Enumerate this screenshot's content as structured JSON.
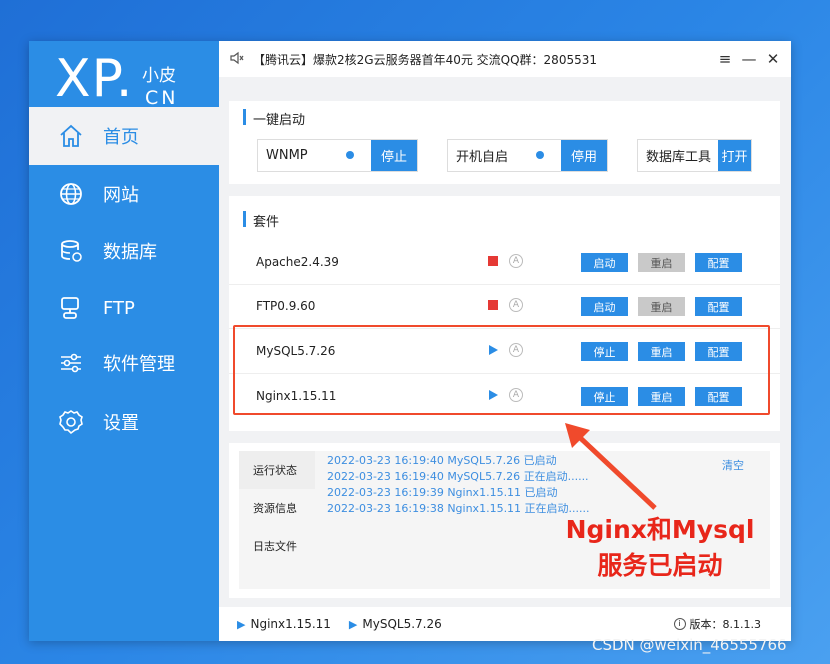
{
  "sidebar": {
    "logo": {
      "xp": "XP.",
      "small": "小皮",
      "cn": "CN"
    },
    "items": [
      {
        "label": "首页",
        "icon": "home-icon",
        "active": true
      },
      {
        "label": "网站",
        "icon": "globe-icon"
      },
      {
        "label": "数据库",
        "icon": "database-icon"
      },
      {
        "label": "FTP",
        "icon": "server-icon"
      },
      {
        "label": "软件管理",
        "icon": "sliders-icon"
      },
      {
        "label": "设置",
        "icon": "gear-icon"
      }
    ]
  },
  "titlebar": {
    "text": "【腾讯云】爆款2核2G云服务器首年40元 交流QQ群：2805531",
    "menu": "≡",
    "minimize": "—",
    "close": "✕"
  },
  "quickstart": {
    "title": "一键启动",
    "wnmp": {
      "label": "WNMP",
      "button": "停止"
    },
    "autostart": {
      "label": "开机自启",
      "button": "停用"
    },
    "dbtool": {
      "label": "数据库工具",
      "button": "打开"
    }
  },
  "suite": {
    "title": "套件",
    "rows": [
      {
        "name": "Apache2.4.39",
        "status": "stopped",
        "btn1": "启动",
        "btn2": "重启",
        "btn3": "配置"
      },
      {
        "name": "FTP0.9.60",
        "status": "stopped",
        "btn1": "启动",
        "btn2": "重启",
        "btn3": "配置"
      },
      {
        "name": "MySQL5.7.26",
        "status": "running",
        "btn1": "停止",
        "btn2": "重启",
        "btn3": "配置"
      },
      {
        "name": "Nginx1.15.11",
        "status": "running",
        "btn1": "停止",
        "btn2": "重启",
        "btn3": "配置"
      }
    ],
    "auto_glyph": "A"
  },
  "log": {
    "tabs": [
      "运行状态",
      "资源信息",
      "日志文件"
    ],
    "clear": "清空",
    "lines": [
      "2022-03-23 16:19:40 MySQL5.7.26 已启动",
      "2022-03-23 16:19:40 MySQL5.7.26 正在启动......",
      "2022-03-23 16:19:39 Nginx1.15.11 已启动",
      "2022-03-23 16:19:38 Nginx1.15.11 正在启动......"
    ]
  },
  "footer": {
    "running1": "Nginx1.15.11",
    "running2": "MySQL5.7.26",
    "version": "版本：8.1.1.3"
  },
  "annotation": {
    "line1": "Nginx和Mysql",
    "line2": "服务已启动"
  },
  "watermark": "CSDN @weixin_46555766",
  "colors": {
    "accent": "#2b8de5",
    "stopped": "#e53935",
    "annotation": "#e8261a"
  }
}
